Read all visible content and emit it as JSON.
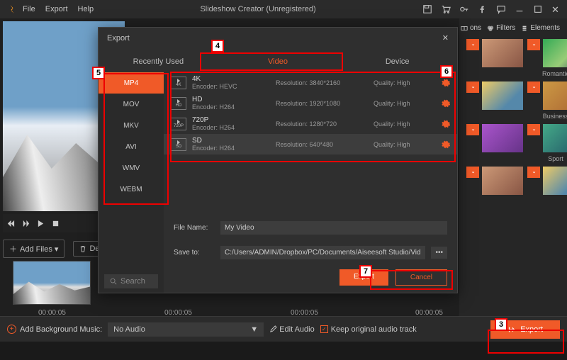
{
  "title": "Slideshow Creator (Unregistered)",
  "menu": {
    "file": "File",
    "export": "Export",
    "help": "Help"
  },
  "player": {
    "addfiles": "Add Files ▾",
    "delete": "Delete"
  },
  "timestamps": [
    "00:00:05",
    "00:00:05",
    "00:00:05",
    "00:00:05"
  ],
  "right": {
    "tabs": {
      "transitions": "ons",
      "filters": "Filters",
      "elements": "Elements"
    },
    "cats": [
      "Romantic",
      "Business",
      "Sport"
    ]
  },
  "footer": {
    "addbgm": "Add Background Music:",
    "noaudio": "No Audio",
    "editaudio": "Edit Audio",
    "keep": "Keep original audio track",
    "export": "Export"
  },
  "dialog": {
    "title": "Export",
    "tabs": {
      "recent": "Recently Used",
      "video": "Video",
      "device": "Device"
    },
    "formats": [
      "MP4",
      "MOV",
      "MKV",
      "AVI",
      "WMV",
      "WEBM"
    ],
    "search": "Search",
    "rows": [
      {
        "badge": "4K",
        "name": "4K",
        "enc": "Encoder: HEVC",
        "res": "Resolution: 3840*2160",
        "q": "Quality: High"
      },
      {
        "badge": "HD",
        "name": "HD",
        "enc": "Encoder: H264",
        "res": "Resolution: 1920*1080",
        "q": "Quality: High"
      },
      {
        "badge": "720P",
        "name": "720P",
        "enc": "Encoder: H264",
        "res": "Resolution: 1280*720",
        "q": "Quality: High"
      },
      {
        "badge": "SD",
        "name": "SD",
        "enc": "Encoder: H264",
        "res": "Resolution: 640*480",
        "q": "Quality: High"
      }
    ],
    "filename_lbl": "File Name:",
    "filename": "My Video",
    "saveto_lbl": "Save to:",
    "saveto": "C:/Users/ADMIN/Dropbox/PC/Documents/Aiseesoft Studio/Video",
    "export": "Export",
    "cancel": "Cancel"
  },
  "annotations": {
    "n3": "3",
    "n4": "4",
    "n5": "5",
    "n6": "6",
    "n7": "7"
  }
}
